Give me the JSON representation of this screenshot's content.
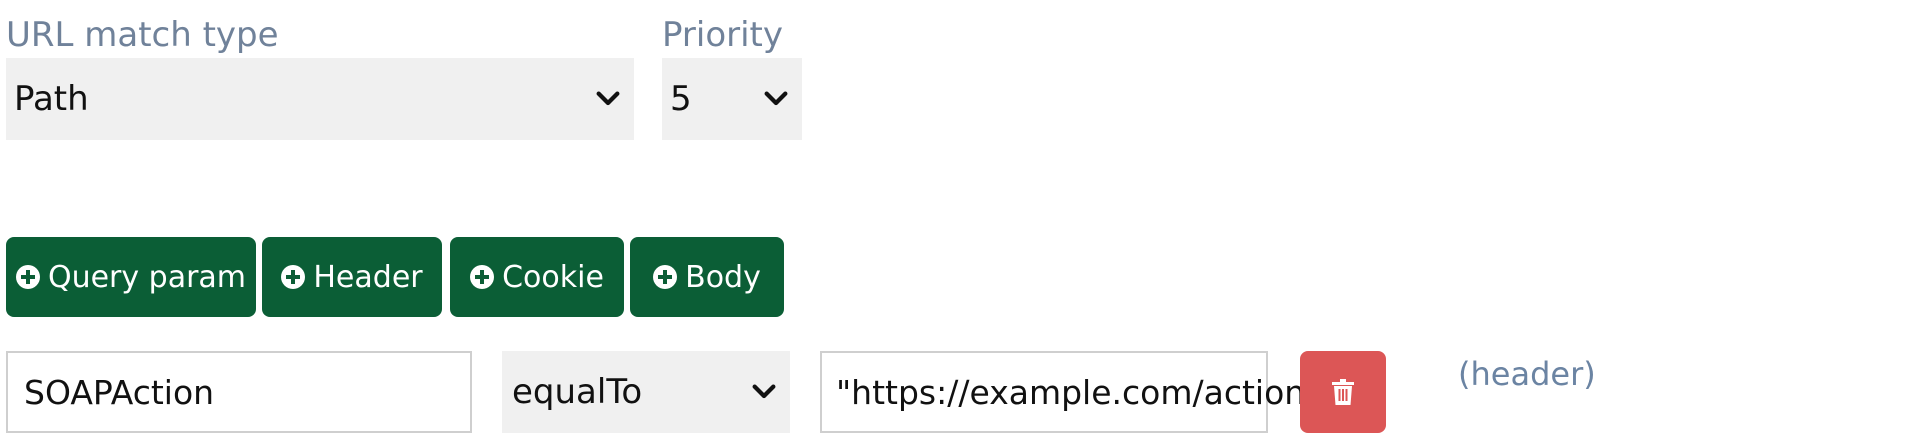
{
  "url_match": {
    "label": "URL match type",
    "selected": "Path",
    "icon": "chevron-down-icon"
  },
  "priority": {
    "label": "Priority",
    "selected": "5",
    "icon": "chevron-down-icon"
  },
  "add_buttons": {
    "query_param": "Query param",
    "header": "Header",
    "cookie": "Cookie",
    "body": "Body",
    "icon": "plus-circle-icon",
    "color": "#0b5e36"
  },
  "matcher": {
    "key": "SOAPAction",
    "operator": "equalTo",
    "value": "\"https://example.com/action\"",
    "delete_icon": "trash-icon",
    "delete_color": "#dc5656",
    "type_label": "(header)"
  }
}
